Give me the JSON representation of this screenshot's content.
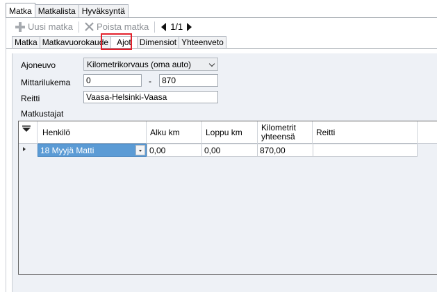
{
  "top_tabs": [
    {
      "label": "Matka",
      "active": true
    },
    {
      "label": "Matkalista",
      "active": false
    },
    {
      "label": "Hyväksyntä",
      "active": false
    }
  ],
  "toolbar": {
    "new_label": "Uusi matka",
    "delete_label": "Poista matka",
    "page": "1/1"
  },
  "sub_tabs": [
    {
      "label": "Matka",
      "active": false
    },
    {
      "label": "Matkavuorokaude",
      "active": false
    },
    {
      "label": "Ajot",
      "active": true
    },
    {
      "label": "Dimensiot",
      "active": false
    },
    {
      "label": "Yhteenveto",
      "active": false
    }
  ],
  "form": {
    "vehicle_label": "Ajoneuvo",
    "vehicle_value": "Kilometrikorvaus (oma auto)",
    "odometer_label": "Mittarilukema",
    "odometer_start": "0",
    "odometer_separator": "-",
    "odometer_end": "870",
    "route_label": "Reitti",
    "route_value": "Vaasa-Helsinki-Vaasa"
  },
  "travellers": {
    "section_label": "Matkustajat",
    "columns": [
      "Henkilö",
      "Alku km",
      "Loppu km",
      "Kilometrit yhteensä",
      "Reitti"
    ],
    "rows": [
      {
        "henkilo": "18 Myyjä Matti",
        "alku_km": "0,00",
        "loppu_km": "0,00",
        "yhteensa": "870,00",
        "reitti": ""
      }
    ]
  },
  "colors": {
    "selected_cell": "#5b9bd5",
    "panel_bg": "#eef1f6",
    "highlight": "#e3202b"
  }
}
